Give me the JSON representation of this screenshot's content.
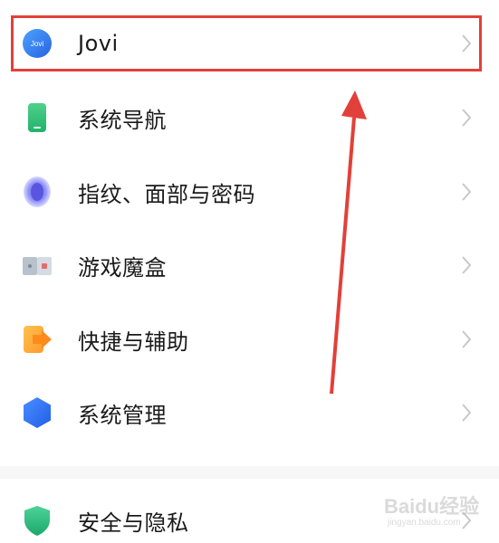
{
  "settings_list": {
    "items": [
      {
        "label": "Jovi",
        "icon": "jovi-icon"
      },
      {
        "label": "系统导航",
        "icon": "phone-navigation-icon"
      },
      {
        "label": "指纹、面部与密码",
        "icon": "fingerprint-icon"
      },
      {
        "label": "游戏魔盒",
        "icon": "game-box-icon"
      },
      {
        "label": "快捷与辅助",
        "icon": "shortcut-arrow-icon"
      },
      {
        "label": "系统管理",
        "icon": "system-management-icon"
      },
      {
        "label": "安全与隐私",
        "icon": "security-shield-icon"
      }
    ]
  },
  "annotation": {
    "highlight_color": "#e2403a",
    "arrow_color": "#e2403a"
  },
  "jovi_icon_text": "Jovi",
  "watermark": {
    "brand": "Baidu经验",
    "sub": "jingyan.baidu.com"
  }
}
